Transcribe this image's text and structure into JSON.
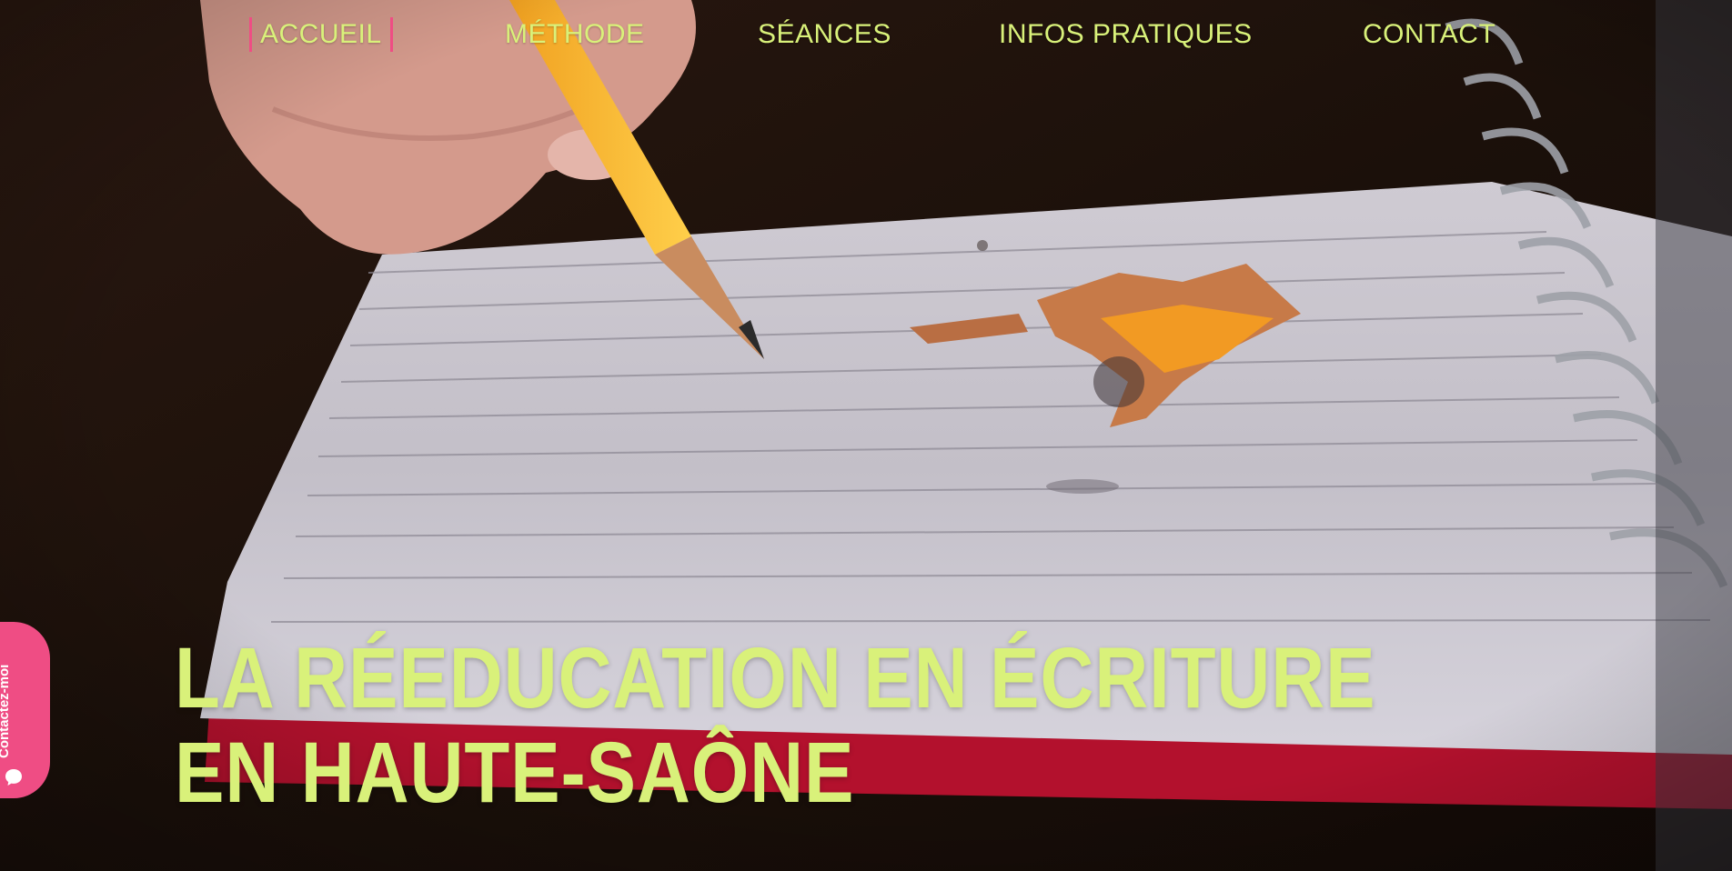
{
  "nav": {
    "items": [
      {
        "label": "ACCUEIL",
        "active": true
      },
      {
        "label": "MÉTHODE",
        "active": false
      },
      {
        "label": "SÉANCES",
        "active": false
      },
      {
        "label": "INFOS PRATIQUES",
        "active": false
      },
      {
        "label": "CONTACT",
        "active": false
      }
    ]
  },
  "hero": {
    "headline_line1": "LA RÉEDUCATION EN ÉCRITURE",
    "headline_line2": "EN HAUTE-SAÔNE",
    "image_icon": "notebook-pencil-photo"
  },
  "contact_tab": {
    "label": "Contactez-moi",
    "icon": "chat-bubble-icon"
  },
  "colors": {
    "accent_text": "#d9f17a",
    "accent_pink": "#ef4d84",
    "background": "#1e120c"
  }
}
